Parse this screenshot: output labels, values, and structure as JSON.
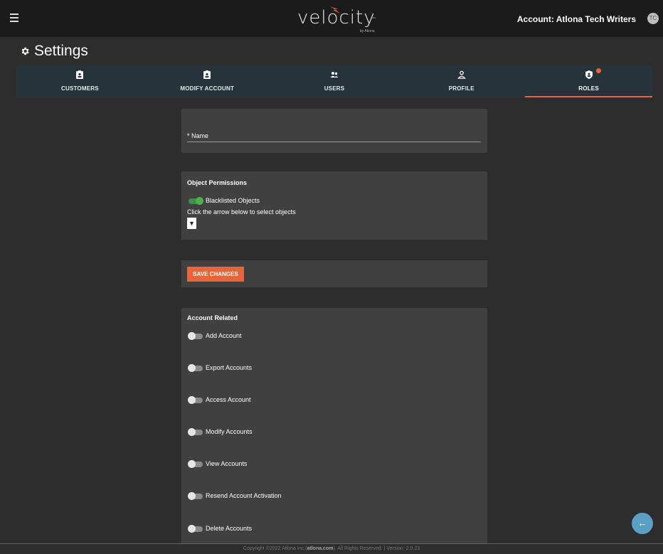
{
  "header": {
    "logo_word": "velocity",
    "logo_tm": "™",
    "logo_sub": "by Atlona",
    "account_label": "Account: Atlona Tech Writers",
    "avatar_initials": "TC"
  },
  "page": {
    "title": "Settings"
  },
  "tabs": [
    {
      "label": "CUSTOMERS",
      "icon": "badge-icon"
    },
    {
      "label": "MODIFY ACCOUNT",
      "icon": "badge-icon"
    },
    {
      "label": "USERS",
      "icon": "users-icon"
    },
    {
      "label": "PROFILE",
      "icon": "person-icon"
    },
    {
      "label": "ROLES",
      "icon": "shield-icon",
      "active": true
    }
  ],
  "name_section": {
    "label": "* Name"
  },
  "object_permissions": {
    "title": "Object Permissions",
    "toggle_label": "Blacklisted Objects",
    "toggle_on": true,
    "hint": "Click the arrow below to select objects",
    "arrow": "▼"
  },
  "save": {
    "label": "SAVE CHANGES"
  },
  "account_related": {
    "title": "Account Related",
    "items": [
      "Add Account",
      "Export Accounts",
      "Access Account",
      "Modify Accounts",
      "View Accounts",
      "Resend Account Activation",
      "Delete Accounts"
    ]
  },
  "footer": {
    "pre": "Copyright ©2022 Atlona Inc.(",
    "link": "atlona.com",
    "post": "). All Rights Reserved. | Version: 2.0.23"
  },
  "fab": {
    "symbol": "←"
  },
  "colors": {
    "accent": "#e8643a",
    "tabbar": "#27333b",
    "card": "#404040",
    "toggle_on": "#4caf50",
    "fab": "#5b9fc4"
  }
}
